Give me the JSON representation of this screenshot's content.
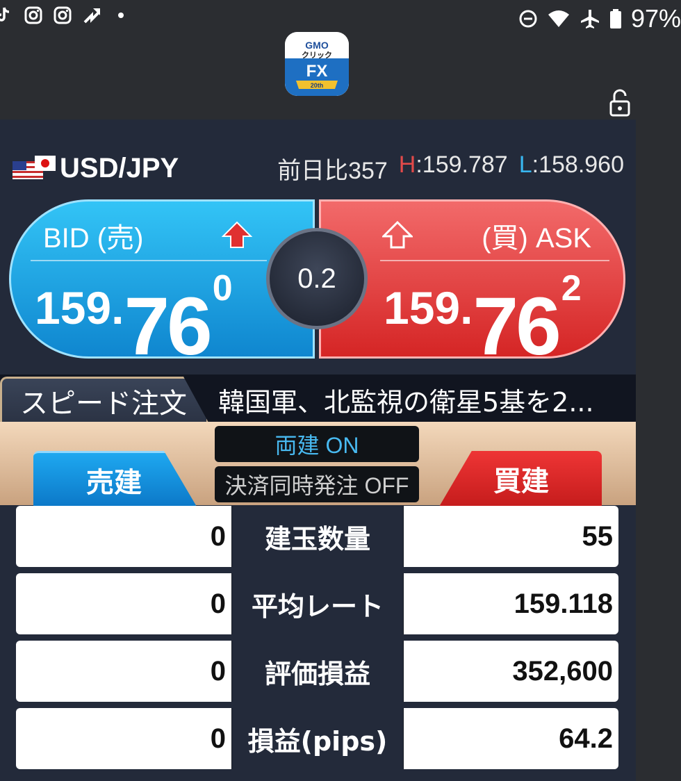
{
  "statusbar": {
    "icons_left": [
      "tiktok-icon",
      "instagram-icon",
      "instagram-icon",
      "sync-arrow-icon",
      "dot-icon"
    ],
    "icons_right": [
      "dnd-icon",
      "wifi-icon",
      "airplane-icon",
      "battery-icon"
    ],
    "battery": "97%"
  },
  "app": {
    "logo_line1": "GMO",
    "logo_line2": "クリック",
    "logo_line3": "FX",
    "logo_badge": "20th"
  },
  "pair": {
    "name": "USD/JPY",
    "change_label": "前日比",
    "change_value": "357",
    "high_label": "H",
    "high_value": ":159.787",
    "low_label": "L",
    "low_value": ":158.960"
  },
  "bid": {
    "label": "BID (売)",
    "price_small": "159.",
    "price_big": "76",
    "price_sup": "0"
  },
  "ask": {
    "label": "(買) ASK",
    "price_small": "159.",
    "price_big": "76",
    "price_sup": "2"
  },
  "spread": "0.2",
  "speed_order": {
    "tab_label": "スピード注文",
    "news": "韓国軍、北監視の衛星5基を2..."
  },
  "order": {
    "sell_label": "売建",
    "buy_label": "買建",
    "hedge_toggle": "両建 ON",
    "settle_toggle": "決済同時発注 OFF"
  },
  "table": [
    {
      "left": "0",
      "label": "建玉数量",
      "right": "55"
    },
    {
      "left": "0",
      "label": "平均レート",
      "right": "159.118"
    },
    {
      "left": "0",
      "label": "評価損益",
      "right": "352,600"
    },
    {
      "left": "0",
      "label": "損益(pips)",
      "right": "64.2"
    }
  ],
  "colors": {
    "bid": "#1ea8f0",
    "ask": "#e23434",
    "high": "#e24a4a",
    "low": "#38b6ef",
    "panel": "#232a3a"
  }
}
